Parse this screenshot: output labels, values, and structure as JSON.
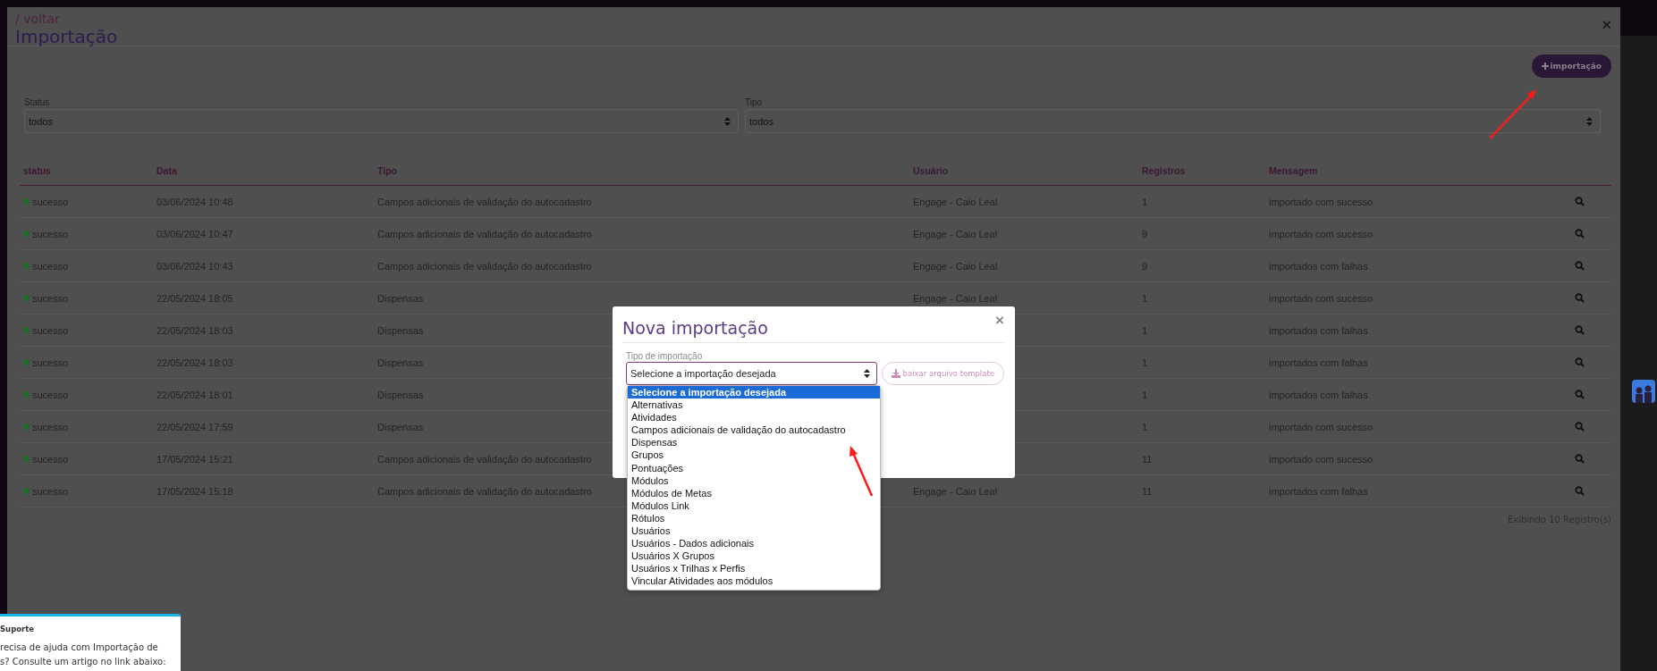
{
  "header": {
    "back_link": "/ voltar",
    "title": "Importação",
    "close": "×"
  },
  "new_button": {
    "label": "importação"
  },
  "filters": [
    {
      "label": "Status",
      "value": "todos"
    },
    {
      "label": "Tipo",
      "value": "todos"
    }
  ],
  "table": {
    "columns": [
      "status",
      "Data",
      "Tipo",
      "Usuário",
      "Registros",
      "Mensagem"
    ],
    "rows": [
      {
        "status": "sucesso",
        "color": "#1e6a28",
        "date": "03/06/2024 10:48",
        "type": "Campos adicionais de validação do autocadastro",
        "user": "Engage - Caio Leal",
        "records": "1",
        "message": "importado com sucesso"
      },
      {
        "status": "sucesso",
        "color": "#1e6a28",
        "date": "03/06/2024 10:47",
        "type": "Campos adicionais de validação do autocadastro",
        "user": "Engage - Caio Leal",
        "records": "9",
        "message": "importado com sucesso"
      },
      {
        "status": "sucesso",
        "color": "#1e6a28",
        "date": "03/06/2024 10:43",
        "type": "Campos adicionais de validação do autocadastro",
        "user": "Engage - Caio Leal",
        "records": "9",
        "message": "importados com falhas"
      },
      {
        "status": "sucesso",
        "color": "#1e6a28",
        "date": "22/05/2024 18:05",
        "type": "Dispensas",
        "user": "Engage - Caio Leal",
        "records": "1",
        "message": "importado com sucesso"
      },
      {
        "status": "sucesso",
        "color": "#1e6a28",
        "date": "22/05/2024 18:03",
        "type": "Dispensas",
        "records": "1",
        "message": "importados com falhas"
      },
      {
        "status": "sucesso",
        "color": "#1e6a28",
        "date": "22/05/2024 18:03",
        "type": "Dispensas",
        "records": "1",
        "message": "importados com falhas"
      },
      {
        "status": "sucesso",
        "color": "#1e6a28",
        "date": "22/05/2024 18:01",
        "type": "Dispensas",
        "records": "1",
        "message": "importados com falhas"
      },
      {
        "status": "sucesso",
        "color": "#1e6a28",
        "date": "22/05/2024 17:59",
        "type": "Dispensas",
        "records": "1",
        "message": "importado com sucesso"
      },
      {
        "status": "sucesso",
        "color": "#1e6a28",
        "date": "17/05/2024 15:21",
        "type": "Campos adicionais de validação do autocadastro",
        "records": "11",
        "message": "importado com sucesso"
      },
      {
        "status": "sucesso",
        "color": "#1e6a28",
        "date": "17/05/2024 15:18",
        "type": "Campos adicionais de validação do autocadastro",
        "user": "Engage - Caio Leal",
        "records": "11",
        "message": "importados com falhas"
      }
    ],
    "footer": "Exibindo 10 Registro(s)"
  },
  "modal": {
    "title": "Nova importação",
    "close": "×",
    "field_label": "Tipo de importação",
    "select_value": "Selecione a importação desejada",
    "template_button": {
      "label": "baixar arquivo template",
      "disabled": true
    },
    "options": [
      {
        "label": "Selecione a importação desejada",
        "selected": true
      },
      {
        "label": "Alternativas",
        "selected": false
      },
      {
        "label": "Atividades",
        "selected": false
      },
      {
        "label": "Campos adicionais de validação do autocadastro",
        "selected": false
      },
      {
        "label": "Dispensas",
        "selected": false
      },
      {
        "label": "Grupos",
        "selected": false
      },
      {
        "label": "Pontuações",
        "selected": false
      },
      {
        "label": "Módulos",
        "selected": false
      },
      {
        "label": "Módulos de Metas",
        "selected": false
      },
      {
        "label": "Módulos Link",
        "selected": false
      },
      {
        "label": "Rótulos",
        "selected": false
      },
      {
        "label": "Usuários",
        "selected": false
      },
      {
        "label": "Usuários - Dados adicionais",
        "selected": false
      },
      {
        "label": "Usuários X Grupos",
        "selected": false
      },
      {
        "label": "Usuários x Trilhas x Perfis",
        "selected": false
      },
      {
        "label": "Vincular Atividades aos módulos",
        "selected": false
      }
    ]
  },
  "support": {
    "title": "Suporte",
    "lines": [
      "recisa de ajuda com Importação de",
      "s? Consulte um artigo no link abaixo:"
    ]
  }
}
